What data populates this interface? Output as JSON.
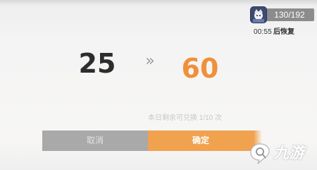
{
  "stamina": {
    "icon": "character-portrait-icon",
    "count": "130/192",
    "recover_time": "00:55",
    "recover_label": "后恢复"
  },
  "exchange": {
    "from_value": "25",
    "arrow": "»",
    "to_value": "60",
    "hint": "本日剩余可兑换 1/10 次"
  },
  "buttons": {
    "cancel_label": "取消",
    "confirm_label": "确定"
  },
  "watermark": {
    "logo": "jiuyou-logo-icon",
    "text": "九游"
  },
  "colors": {
    "accent": "#f0903a",
    "confirm_bg": "#f0a24e",
    "cancel_bg": "#a9a9a9",
    "stamina_box": "#8c8c8c"
  }
}
